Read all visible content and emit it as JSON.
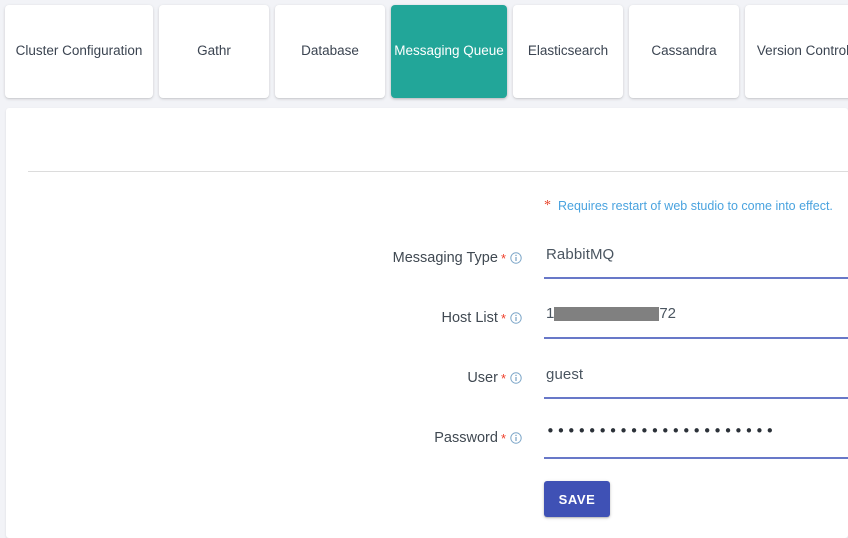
{
  "tabs": [
    {
      "label": "Cluster Configuration",
      "active": false
    },
    {
      "label": "Gathr",
      "active": false
    },
    {
      "label": "Database",
      "active": false
    },
    {
      "label": "Messaging Queue",
      "active": true
    },
    {
      "label": "Elasticsearch",
      "active": false
    },
    {
      "label": "Cassandra",
      "active": false
    },
    {
      "label": "Version Control",
      "active": false
    }
  ],
  "note": {
    "asterisk": "*",
    "text": "Requires restart of web studio to come into effect."
  },
  "form": {
    "fields": [
      {
        "label": "Messaging Type",
        "required_mark": "*",
        "info_icon": "info-circle-icon",
        "value": "RabbitMQ",
        "type": "text"
      },
      {
        "label": "Host List",
        "required_mark": "*",
        "info_icon": "info-circle-icon",
        "value_prefix": "1",
        "value_suffix": "72",
        "redacted": true,
        "type": "redacted"
      },
      {
        "label": "User",
        "required_mark": "*",
        "info_icon": "info-circle-icon",
        "value": "guest",
        "type": "text"
      },
      {
        "label": "Password",
        "required_mark": "*",
        "info_icon": "info-circle-icon",
        "value": "••••••••••••••••••••••",
        "type": "password"
      }
    ]
  },
  "actions": {
    "save_label": "SAVE"
  },
  "colors": {
    "active_tab": "#22a699",
    "save_button": "#3f51b5",
    "underline": "#6878c8",
    "required": "#ef3e2a",
    "note_text": "#4aa3df",
    "page_background": "#f2f3f7"
  }
}
